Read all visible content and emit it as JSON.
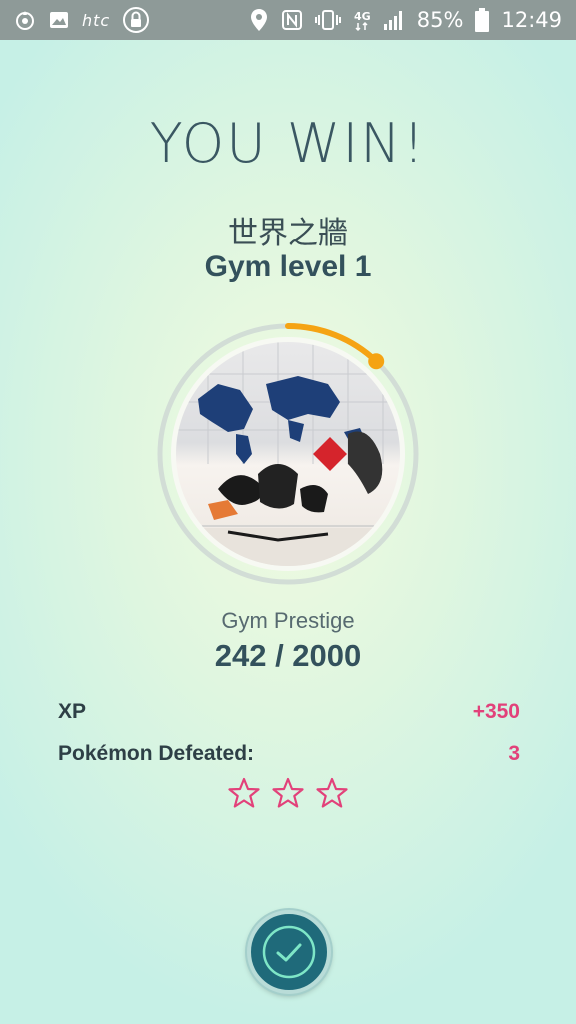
{
  "status_bar": {
    "left_icons": [
      "pokeball-notification-icon",
      "image-icon",
      "htc-logo",
      "lock-icon"
    ],
    "htc_text": "htc",
    "right_icons": [
      "location-icon",
      "nfc-icon",
      "vibrate-icon",
      "4g-icon",
      "signal-icon",
      "battery-icon"
    ],
    "battery": "85%",
    "time": "12:49"
  },
  "title": "YOU WIN!",
  "gym": {
    "name": "世界之牆",
    "level": "Gym level 1",
    "photo_icon": "gym-photo-world-map-wall"
  },
  "prestige": {
    "label": "Gym Prestige",
    "text": "242 / 2000",
    "current": 242,
    "max": 2000
  },
  "stats": {
    "xp_label": "XP",
    "xp_value": "+350",
    "defeated_label": "Pokémon Defeated:",
    "defeated_value": "3"
  },
  "stars": {
    "count": 3,
    "filled": 0
  },
  "colors": {
    "accent_pink": "#e2417a",
    "progress_orange": "#f5a313",
    "ring_track": "#d2ddd6",
    "button_teal": "#1f6a7a"
  },
  "confirm_icon": "checkmark-icon"
}
